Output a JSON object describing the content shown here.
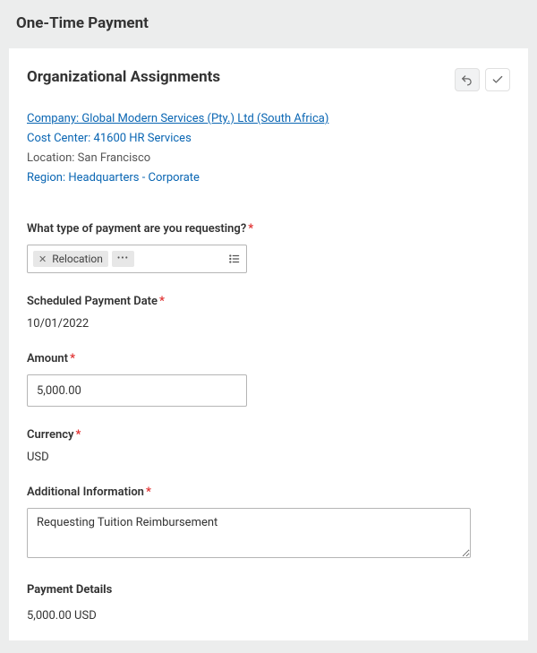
{
  "page": {
    "title": "One-Time Payment"
  },
  "card": {
    "title": "Organizational Assignments"
  },
  "org": {
    "company": "Company: Global Modern Services (Pty.) Ltd (South Africa)",
    "costCenter": "Cost Center: 41600 HR Services",
    "location": "Location: San Francisco",
    "region": "Region: Headquarters - Corporate"
  },
  "form": {
    "paymentType": {
      "label": "What type of payment are you requesting?",
      "selected": "Relocation"
    },
    "scheduledDate": {
      "label": "Scheduled Payment Date",
      "value": "10/01/2022"
    },
    "amount": {
      "label": "Amount",
      "value": "5,000.00"
    },
    "currency": {
      "label": "Currency",
      "value": "USD"
    },
    "additionalInfo": {
      "label": "Additional Information",
      "value": "Requesting Tuition Reimbursement"
    }
  },
  "details": {
    "title": "Payment Details",
    "summary": "5,000.00 USD"
  }
}
